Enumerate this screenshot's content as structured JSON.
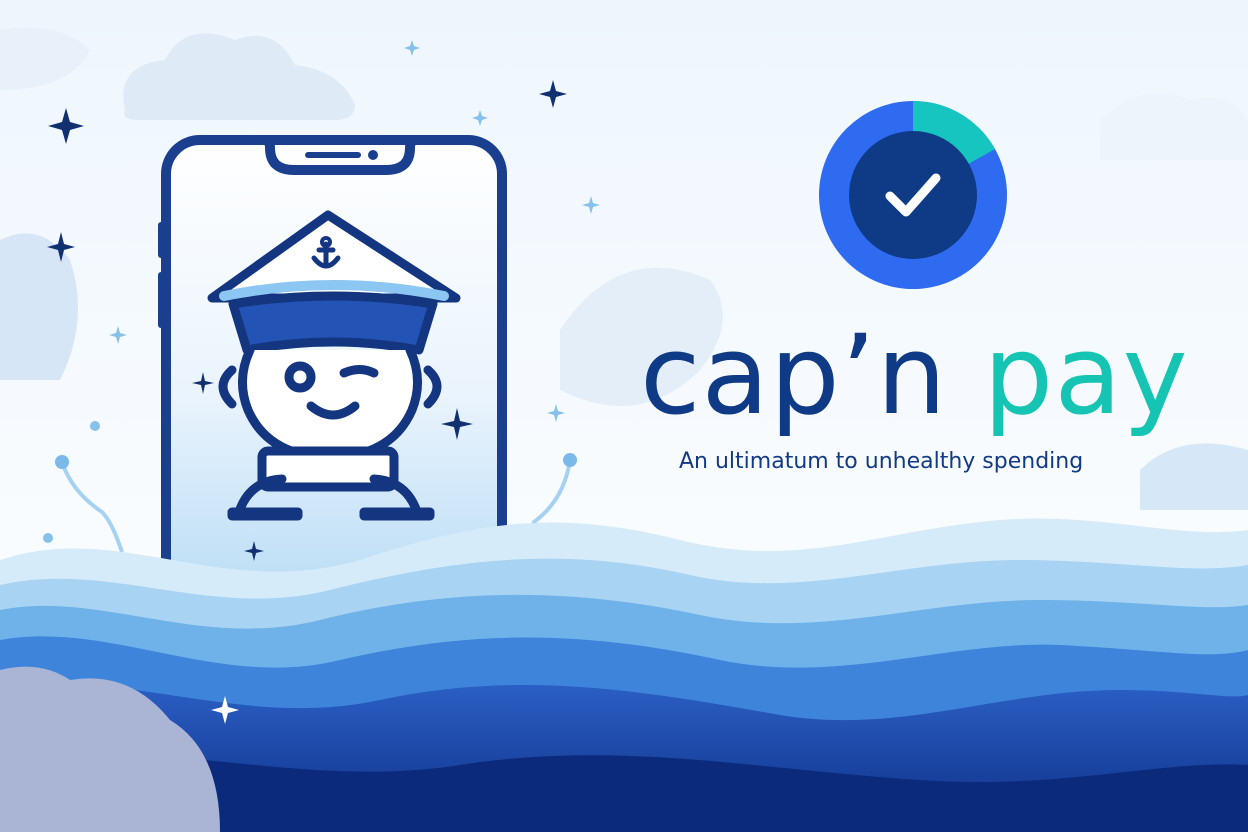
{
  "brand": {
    "name_part1": "cap’n",
    "name_part2": "pay",
    "tagline": "An ultimatum to unhealthy spending"
  },
  "logo": {
    "icon": "checkmark-ring-icon",
    "ring_progress": 0.12
  },
  "illustration": {
    "icon": "captain-phone-icon"
  },
  "colors": {
    "navy": "#0f3a85",
    "teal": "#16c4b3",
    "royal_blue": "#2f6bf0",
    "sky": "#9fd0f2"
  }
}
